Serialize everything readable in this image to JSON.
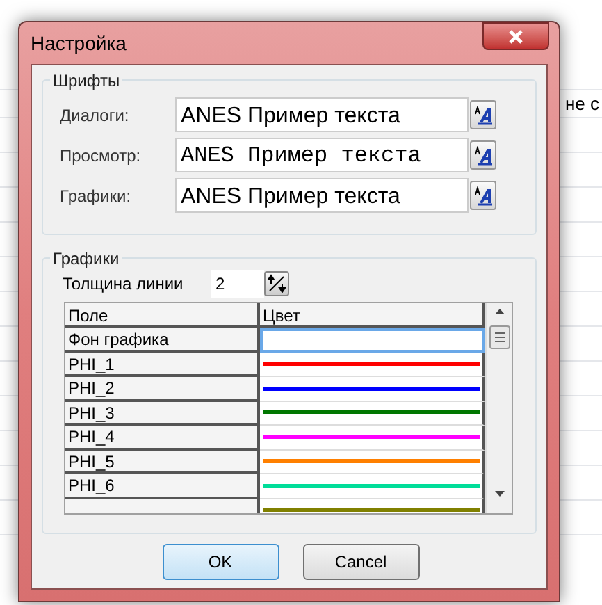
{
  "background": {
    "text": "не с"
  },
  "window": {
    "title": "Настройка"
  },
  "fonts": {
    "title": "Шрифты",
    "rows": [
      {
        "label": "Диалоги:",
        "sample": "ANES Пример текста",
        "kind": "sans"
      },
      {
        "label": "Просмотр:",
        "sample": "ANES Пример текста",
        "kind": "mono"
      },
      {
        "label": "Графики:",
        "sample": "ANES Пример текста",
        "kind": "sans"
      }
    ]
  },
  "graphics": {
    "title": "Графики",
    "line_width": {
      "label": "Толщина линии",
      "value": "2"
    },
    "table": {
      "columns": [
        "Поле",
        "Цвет"
      ],
      "rows": [
        {
          "name": "Фон графика",
          "kind": "blank",
          "selected": true
        },
        {
          "name": "PHI_1",
          "kind": "line",
          "color": "#ff0000",
          "selected": false
        },
        {
          "name": "PHI_2",
          "kind": "line",
          "color": "#0000ff",
          "selected": false
        },
        {
          "name": "PHI_3",
          "kind": "line",
          "color": "#007700",
          "selected": false
        },
        {
          "name": "PHI_4",
          "kind": "line",
          "color": "#ff00ff",
          "selected": false
        },
        {
          "name": "PHI_5",
          "kind": "line",
          "color": "#ff8000",
          "selected": false
        },
        {
          "name": "PHI_6",
          "kind": "line",
          "color": "#00dd99",
          "selected": false
        },
        {
          "kind": "line",
          "color": "#808000",
          "selected": false
        }
      ]
    }
  },
  "buttons": [
    {
      "label": "OK",
      "default": true
    },
    {
      "label": "Cancel",
      "default": false
    }
  ]
}
